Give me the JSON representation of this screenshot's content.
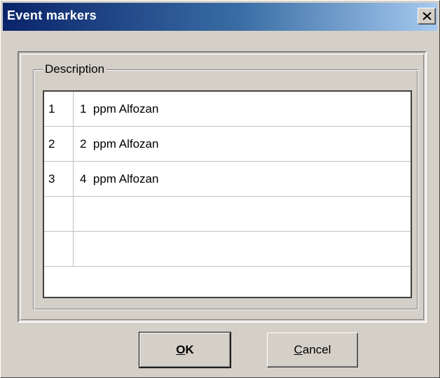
{
  "window": {
    "title": "Event markers"
  },
  "group": {
    "label": "Description"
  },
  "grid": {
    "rows": [
      {
        "num": "1",
        "desc": "1  ppm Alfozan"
      },
      {
        "num": "2",
        "desc": "2  ppm Alfozan"
      },
      {
        "num": "3",
        "desc": "4  ppm Alfozan"
      },
      {
        "num": "",
        "desc": ""
      },
      {
        "num": "",
        "desc": ""
      },
      {
        "num": "",
        "desc": ""
      }
    ]
  },
  "buttons": {
    "ok": {
      "mnemonic": "O",
      "rest": "K"
    },
    "cancel": {
      "mnemonic": "C",
      "rest": "ancel"
    }
  },
  "icons": {
    "close": "close-icon"
  },
  "colors": {
    "title_start": "#0a246a",
    "title_end": "#a6caf0",
    "face": "#d4d0c8"
  }
}
